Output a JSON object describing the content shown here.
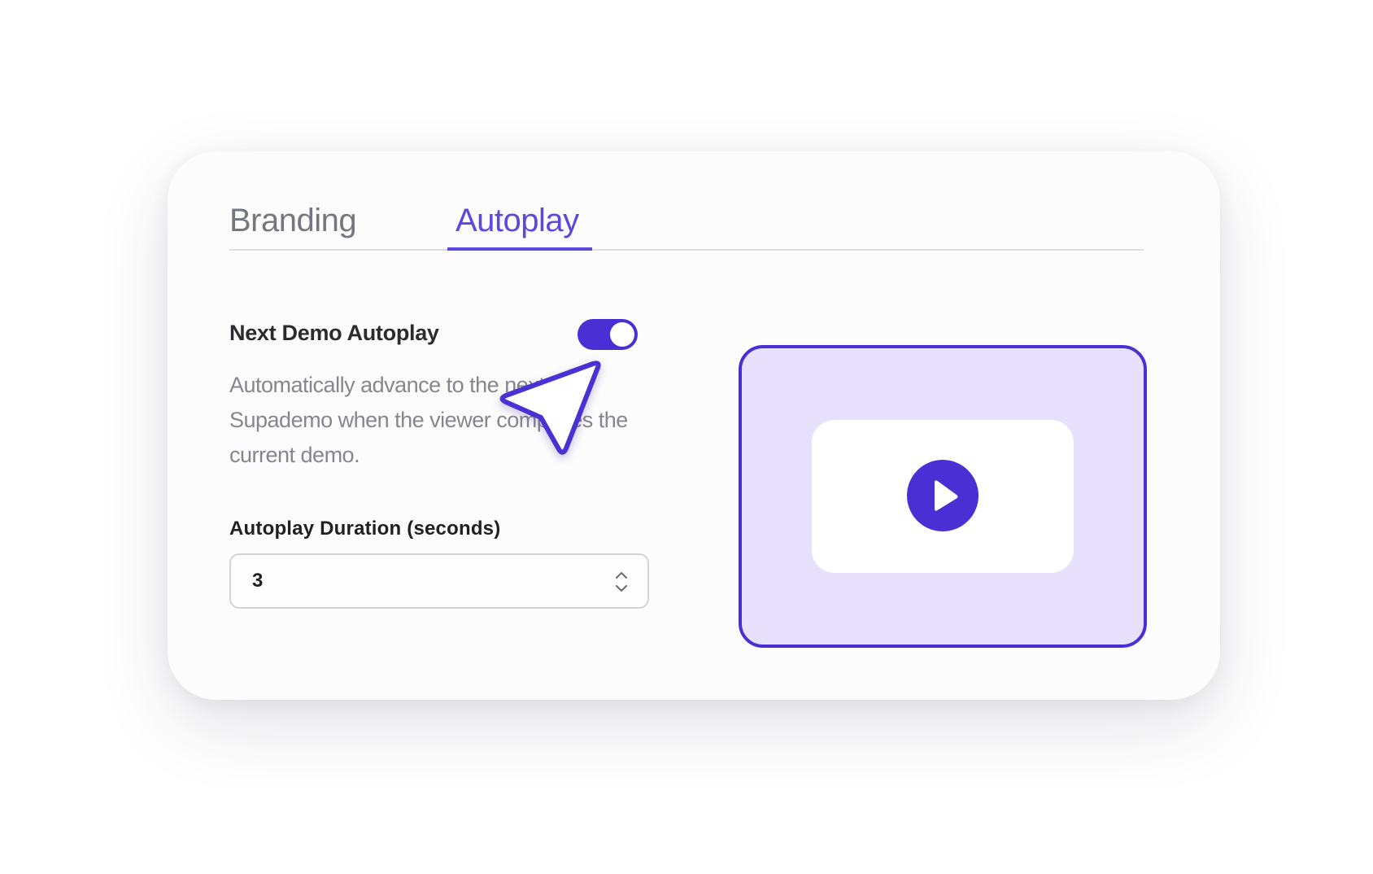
{
  "tabs": [
    {
      "label": "Branding",
      "active": false
    },
    {
      "label": "Autoplay",
      "active": true
    }
  ],
  "setting": {
    "title": "Next Demo Autoplay",
    "enabled": true,
    "description": "Automatically advance to the next Supademo when the viewer completes the current demo."
  },
  "duration": {
    "label": "Autoplay Duration (seconds)",
    "value": "3"
  },
  "icons": {
    "play": "play-icon",
    "stepper": "chevron-up-down-icon",
    "cursor": "pointer-cursor-icon"
  },
  "colors": {
    "accent": "#4a30d4",
    "tab_active": "#5b48dd",
    "preview_bg": "#e7e1fd"
  }
}
